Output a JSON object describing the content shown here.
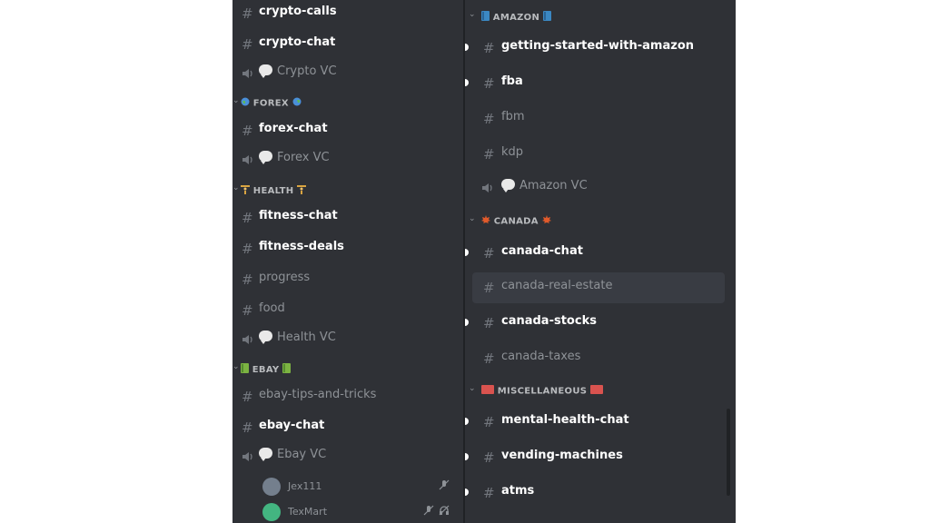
{
  "left": {
    "channels_top": [
      {
        "name": "crypto-calls"
      },
      {
        "name": "crypto-chat"
      },
      {
        "name": "Crypto VC"
      }
    ],
    "forex": {
      "label": "FOREX",
      "channels": [
        {
          "name": "forex-chat"
        },
        {
          "name": "Forex VC"
        }
      ]
    },
    "health": {
      "label": "HEALTH",
      "channels": [
        {
          "name": "fitness-chat"
        },
        {
          "name": "fitness-deals"
        },
        {
          "name": "progress"
        },
        {
          "name": "food"
        },
        {
          "name": "Health VC"
        }
      ]
    },
    "ebay": {
      "label": "EBAY",
      "channels": [
        {
          "name": "ebay-tips-and-tricks"
        },
        {
          "name": "ebay-chat"
        },
        {
          "name": "Ebay VC"
        }
      ]
    },
    "voice_users": [
      {
        "name": "Jex111"
      },
      {
        "name": "TexMart"
      }
    ]
  },
  "right": {
    "amazon": {
      "label": "AMAZON",
      "channels": [
        {
          "name": "getting-started-with-amazon"
        },
        {
          "name": "fba"
        },
        {
          "name": "fbm"
        },
        {
          "name": "kdp"
        },
        {
          "name": "Amazon VC"
        }
      ]
    },
    "canada": {
      "label": "CANADA",
      "channels": [
        {
          "name": "canada-chat"
        },
        {
          "name": "canada-real-estate"
        },
        {
          "name": "canada-stocks"
        },
        {
          "name": "canada-taxes"
        }
      ]
    },
    "misc": {
      "label": "MISCELLANEOUS",
      "channels": [
        {
          "name": "mental-health-chat"
        },
        {
          "name": "vending-machines"
        },
        {
          "name": "atms"
        }
      ]
    }
  },
  "icons": {
    "text_channel": "#",
    "voice_channel": "speaker-icon",
    "category_chevron": "chevron-down-icon"
  },
  "colors": {
    "background": "#2f3136",
    "divider": "#202225",
    "unread_text": "#ffffff",
    "muted_text": "#8e9297",
    "selected_row": "#393c43"
  }
}
